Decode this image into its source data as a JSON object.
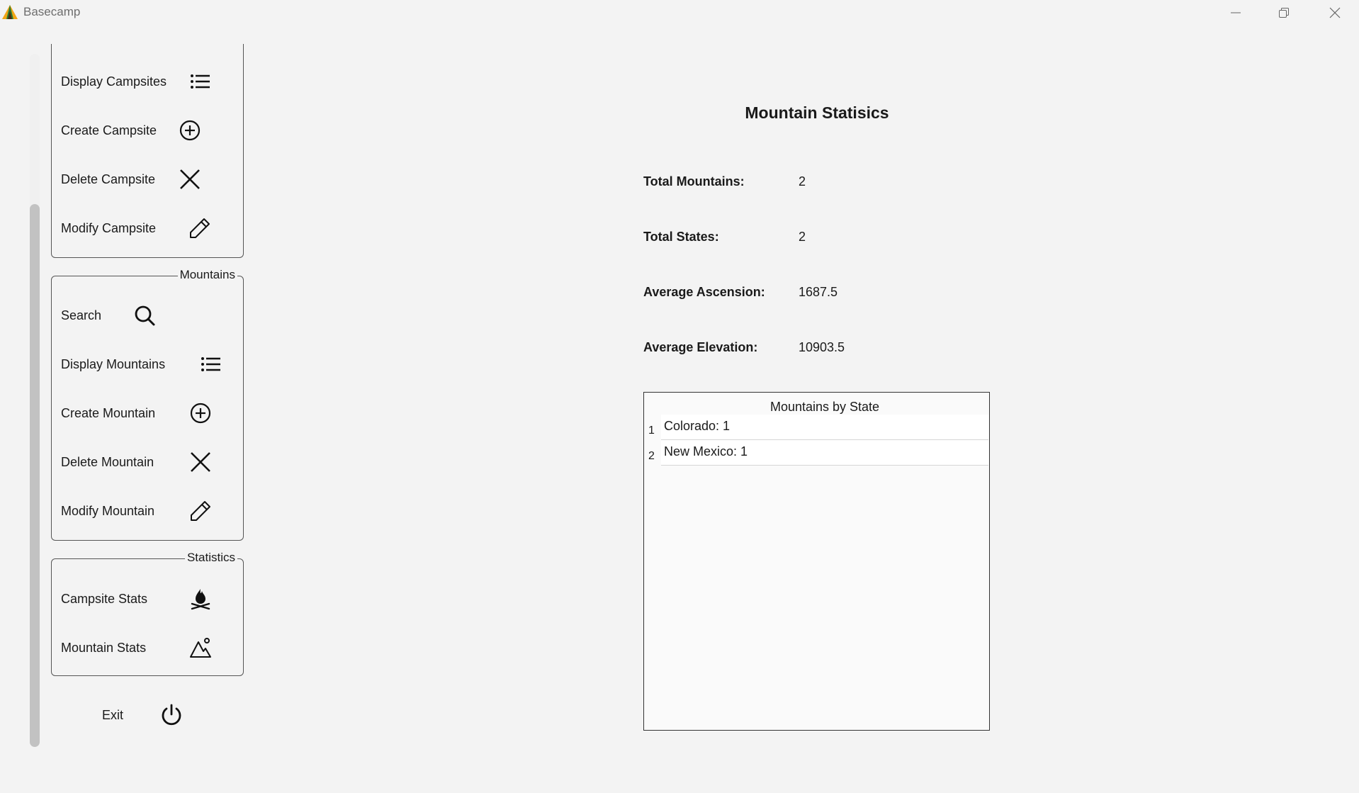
{
  "window": {
    "title": "Basecamp"
  },
  "sidebar": {
    "campsites": {
      "items": [
        {
          "label": "Display Campsites",
          "icon": "list-icon"
        },
        {
          "label": "Create Campsite",
          "icon": "plus-circle-icon"
        },
        {
          "label": "Delete Campsite",
          "icon": "close-icon"
        },
        {
          "label": "Modify Campsite",
          "icon": "pencil-icon"
        }
      ]
    },
    "mountains": {
      "legend": "Mountains",
      "items": [
        {
          "label": "Search",
          "icon": "search-icon"
        },
        {
          "label": "Display Mountains",
          "icon": "list-icon"
        },
        {
          "label": "Create Mountain",
          "icon": "plus-circle-icon"
        },
        {
          "label": "Delete Mountain",
          "icon": "close-icon"
        },
        {
          "label": "Modify Mountain",
          "icon": "pencil-icon"
        }
      ]
    },
    "statistics": {
      "legend": "Statistics",
      "items": [
        {
          "label": "Campsite Stats",
          "icon": "campfire-icon"
        },
        {
          "label": "Mountain Stats",
          "icon": "mountain-icon"
        }
      ]
    },
    "exit": {
      "label": "Exit",
      "icon": "power-icon"
    }
  },
  "main": {
    "title": "Mountain Statisics",
    "stats": [
      {
        "label": "Total Mountains:",
        "value": "2"
      },
      {
        "label": "Total States:",
        "value": "2"
      },
      {
        "label": "Average Ascension:",
        "value": "1687.5"
      },
      {
        "label": "Average Elevation:",
        "value": "10903.5"
      }
    ],
    "table": {
      "header": "Mountains by State",
      "rows": [
        {
          "num": "1",
          "text": "Colorado: 1"
        },
        {
          "num": "2",
          "text": "New Mexico: 1"
        }
      ]
    }
  }
}
